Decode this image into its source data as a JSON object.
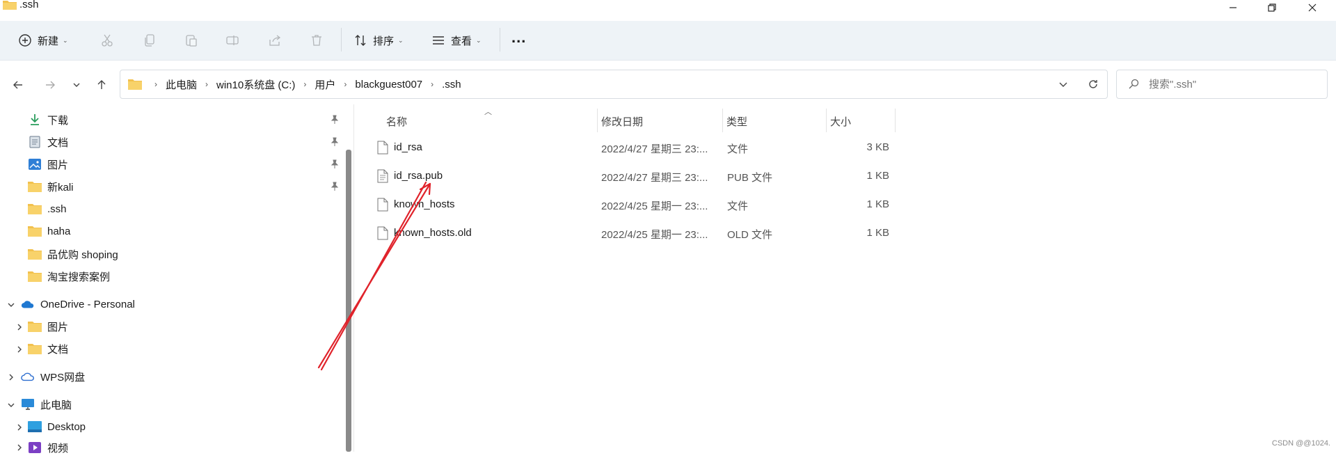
{
  "window": {
    "title": ".ssh",
    "controls": [
      "minimize",
      "restore",
      "close"
    ]
  },
  "toolbar": {
    "new_label": "新建",
    "sort_label": "排序",
    "view_label": "查看",
    "more_label": "...",
    "icons": [
      "plus-icon",
      "cut-icon",
      "copy-icon",
      "paste-icon",
      "rename-icon",
      "share-icon",
      "delete-icon",
      "sort-icon",
      "view-icon"
    ]
  },
  "address": {
    "breadcrumbs": [
      "此电脑",
      "win10系统盘 (C:)",
      "用户",
      "blackguest007",
      ".ssh"
    ]
  },
  "search": {
    "placeholder": "搜索\".ssh\""
  },
  "sidebar": {
    "quick_access": [
      {
        "label": "下载",
        "icon": "download-icon",
        "pinned": true
      },
      {
        "label": "文档",
        "icon": "document-icon",
        "pinned": true
      },
      {
        "label": "图片",
        "icon": "picture-icon",
        "pinned": true
      },
      {
        "label": "新kali",
        "icon": "folder-icon",
        "pinned": true
      },
      {
        "label": ".ssh",
        "icon": "folder-icon",
        "pinned": false
      },
      {
        "label": "haha",
        "icon": "folder-icon",
        "pinned": false
      },
      {
        "label": "品优购 shoping",
        "icon": "folder-icon",
        "pinned": false
      },
      {
        "label": "淘宝搜索案例",
        "icon": "folder-icon",
        "pinned": false
      }
    ],
    "onedrive": {
      "label": "OneDrive - Personal",
      "children": [
        "图片",
        "文档"
      ]
    },
    "wps": {
      "label": "WPS网盘"
    },
    "this_pc": {
      "label": "此电脑",
      "children": [
        "Desktop",
        "视频"
      ]
    }
  },
  "filelist": {
    "columns": [
      "名称",
      "修改日期",
      "类型",
      "大小"
    ],
    "files": [
      {
        "name": "id_rsa",
        "date": "2022/4/27 星期三 23:...",
        "type": "文件",
        "size": "3 KB"
      },
      {
        "name": "id_rsa.pub",
        "date": "2022/4/27 星期三 23:...",
        "type": "PUB 文件",
        "size": "1 KB"
      },
      {
        "name": "known_hosts",
        "date": "2022/4/25 星期一 23:...",
        "type": "文件",
        "size": "1 KB"
      },
      {
        "name": "known_hosts.old",
        "date": "2022/4/25 星期一 23:...",
        "type": "OLD 文件",
        "size": "1 KB"
      }
    ]
  },
  "annotation": {
    "color": "#e0232b"
  },
  "watermark": "CSDN @@1024."
}
